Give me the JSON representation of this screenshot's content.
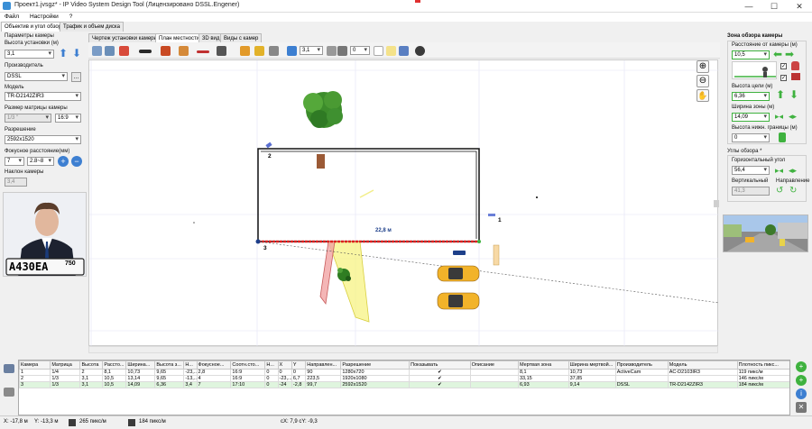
{
  "window": {
    "title": "Проект1.jvsgz* - IP Video System Design Tool (Лицензировано  DSSL.Engener)",
    "minimize": "—",
    "maximize": "☐",
    "close": "✕"
  },
  "menu": [
    "Файл",
    "Настройки",
    "?"
  ],
  "left_tabs": [
    "Объектив и угол обзора",
    "Трафик и объем диска"
  ],
  "camera_params": {
    "group_title": "Параметры камеры",
    "height_label": "Высота установки (м)",
    "height_value": "3,1",
    "manufacturer_label": "Производитель",
    "manufacturer_value": "DSSL",
    "manufacturer_button": "...",
    "model_label": "Модель",
    "model_value": "TR-D2142ZIR3",
    "matrix_label": "Размер матрицы камеры",
    "matrix_value": "1/3 \"",
    "aspect_value": "16:9",
    "resolution_label": "Разрешение",
    "resolution_value": "2592x1520",
    "focal_label": "Фокусное расстояние(мм)",
    "focal_value": "7",
    "focal_range": "2.8~8",
    "tilt_label": "Наклон камеры",
    "tilt_value": "3,4"
  },
  "photo": {
    "plate_text": "A430EA",
    "plate_region": "750"
  },
  "center_tabs": [
    "Чертеж установки камеры",
    "План местности",
    "3D вид",
    "Виды с камер"
  ],
  "toolbar": {
    "scale_value": "3,1",
    "angle_value": "0"
  },
  "plan": {
    "dimension_label": "22,8 м",
    "point_1": "1",
    "point_2": "2",
    "point_3": "3"
  },
  "right_panel": {
    "zone_title": "Зона обзора камеры",
    "distance_label": "Расстояние от камеры (м)",
    "distance_value": "10,5",
    "target_height_label": "Высота цели (м)",
    "target_height_value": "6,36",
    "zone_width_label": "Ширина зоны (м)",
    "zone_width_value": "14,09",
    "lower_bound_label": "Высота нижн. границы (м)",
    "lower_bound_value": "0",
    "angles_title": "Углы обзора *",
    "horizontal_label": "Горизонтальный угол",
    "horizontal_value": "56,4",
    "vertical_label": "Вертикальный",
    "vertical_value": "41,3",
    "direction_label": "Направление"
  },
  "table": {
    "headers": [
      "Камера",
      "Матрица",
      "Высота",
      "Рассто...",
      "Ширина...",
      "Высота з...",
      "Н...",
      "Фокусное...",
      "Соотн.сто...",
      "Н...",
      "X",
      "Y",
      "Направлен...",
      "Разрешение",
      "Показывать",
      "Описание",
      "Мертвая зона",
      "Ширина мертвой...",
      "Производитель",
      "Модель",
      "Плотность пикс..."
    ],
    "rows": [
      [
        "1",
        "1/4",
        "2",
        "8,1",
        "10,73",
        "9,65",
        "-23,...",
        "2,8",
        "16:9",
        "0",
        "0",
        "0",
        "90",
        "1280x720",
        "✔",
        "",
        "8,1",
        "10,73",
        "ActiveCam",
        "AC-D2103IR3",
        "119 пикс/м"
      ],
      [
        "2",
        "1/3",
        "3,1",
        "10,5",
        "13,14",
        "9,65",
        "-13,...",
        "4",
        "16:9",
        "0",
        "-23,...",
        "6,7",
        "223,5",
        "1920x1080",
        "✔",
        "",
        "33,15",
        "37,85",
        "",
        "",
        "146 пикс/м"
      ],
      [
        "3",
        "1/3",
        "3,1",
        "10,5",
        "14,09",
        "6,36",
        "3,4",
        "7",
        "17:10",
        "0",
        "-24",
        "-2,8",
        "99,7",
        "2592x1520",
        "✔",
        "",
        "6,93",
        "9,14",
        "DSSL",
        "TR-D2142ZIR3",
        "184 пикс/м"
      ]
    ]
  },
  "status": {
    "x": "X: -17,8 м",
    "y": "Y: -13,3 м",
    "density_1": "265 пикс/м",
    "density_2": "184 пикс/м",
    "coords": "cX: 7,9 cY: -9,3"
  },
  "colors": {
    "accent_blue": "#3d7fd1",
    "accent_green": "#3fb23f",
    "wall_color": "#111111",
    "dimension_red": "#e02020"
  }
}
